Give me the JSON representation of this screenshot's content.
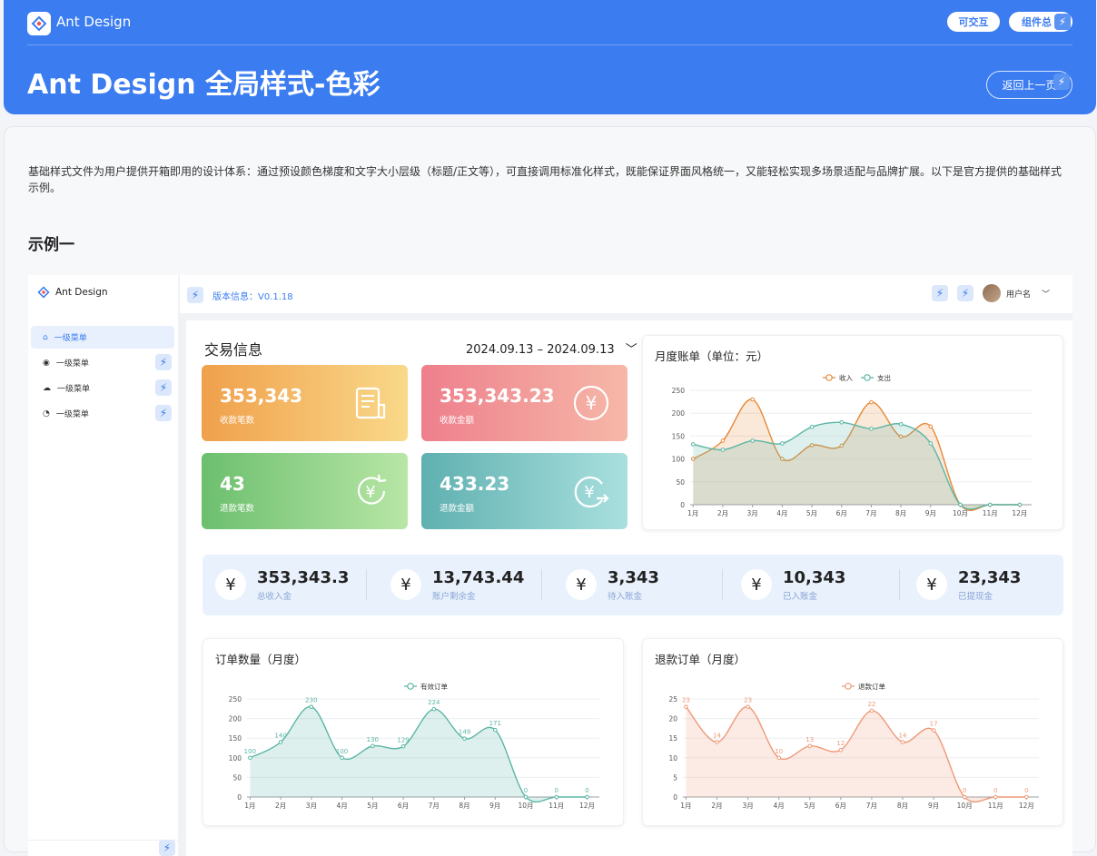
{
  "header": {
    "brand": "Ant Design",
    "title": "Ant Design 全局样式-色彩",
    "interactive_label": "可交互",
    "component_label": "组件总",
    "back_label": "返回上一页"
  },
  "intro": "基础样式文件为用户提供开箱即用的设计体系：通过预设颜色梯度和文字大小层级（标题/正文等），可直接调用标准化样式，既能保证界面风格统一，又能轻松实现多场景适配与品牌扩展。以下是官方提供的基础样式示例。",
  "section_title": "示例一",
  "demo": {
    "brand": "Ant Design",
    "version": "版本信息：V0.1.18",
    "username": "用户名",
    "menu": [
      {
        "label": "一级菜单",
        "icon": "home-icon"
      },
      {
        "label": "一级菜单",
        "icon": "record-icon"
      },
      {
        "label": "一级菜单",
        "icon": "cloud-icon"
      },
      {
        "label": "一级菜单",
        "icon": "pie-icon"
      }
    ],
    "trade_title": "交易信息",
    "date_range": "2024.09.13 – 2024.09.13",
    "cards": [
      {
        "value": "353,343",
        "label": "收款笔数",
        "icon": "receipt-icon",
        "colors": [
          "#f0a04b",
          "#f9d98a"
        ]
      },
      {
        "value": "353,343.23",
        "label": "收款金额",
        "icon": "yen-circle-icon",
        "colors": [
          "#ee7f8c",
          "#f6b8a8"
        ]
      },
      {
        "value": "43",
        "label": "退款笔数",
        "icon": "yen-refresh-icon",
        "colors": [
          "#6cbf6e",
          "#b8e6a6"
        ]
      },
      {
        "value": "433.23",
        "label": "退款金额",
        "icon": "yen-transfer-icon",
        "colors": [
          "#5fb0b0",
          "#a9e0de"
        ]
      }
    ],
    "stats": [
      {
        "value": "353,343.3",
        "label": "总收入金"
      },
      {
        "value": "13,743.44",
        "label": "账户剩余金"
      },
      {
        "value": "3,343",
        "label": "待入账金"
      },
      {
        "value": "10,343",
        "label": "已入账金"
      },
      {
        "value": "23,343",
        "label": "已提现金"
      }
    ]
  },
  "chart_data": [
    {
      "type": "area",
      "title": "月度账单（单位：元）",
      "categories": [
        "1月",
        "2月",
        "3月",
        "4月",
        "5月",
        "6月",
        "7月",
        "8月",
        "9月",
        "10月",
        "11月",
        "12月"
      ],
      "series": [
        {
          "name": "收入",
          "color": "#e58a3a",
          "values": [
            100,
            140,
            230,
            100,
            130,
            129,
            224,
            149,
            171,
            0,
            0,
            0
          ]
        },
        {
          "name": "支出",
          "color": "#5bb6a6",
          "values": [
            132,
            120,
            140,
            134,
            170,
            180,
            166,
            176,
            134,
            0,
            0,
            0
          ]
        }
      ],
      "ylim": [
        0,
        250
      ],
      "yticks": [
        0,
        50,
        100,
        150,
        200,
        250
      ],
      "legend": "top-center"
    },
    {
      "type": "area",
      "title": "订单数量（月度）",
      "categories": [
        "1月",
        "2月",
        "3月",
        "4月",
        "5月",
        "6月",
        "7月",
        "8月",
        "9月",
        "10月",
        "11月",
        "12月"
      ],
      "series": [
        {
          "name": "有效订单",
          "color": "#5bb6a6",
          "values": [
            100,
            140,
            230,
            100,
            130,
            129,
            224,
            149,
            171,
            0,
            0,
            0
          ]
        }
      ],
      "ylim": [
        0,
        250
      ],
      "yticks": [
        0,
        50,
        100,
        150,
        200,
        250
      ],
      "data_labels": true,
      "legend": "top-center"
    },
    {
      "type": "area",
      "title": "退款订单（月度）",
      "categories": [
        "1月",
        "2月",
        "3月",
        "4月",
        "5月",
        "6月",
        "7月",
        "8月",
        "9月",
        "10月",
        "11月",
        "12月"
      ],
      "series": [
        {
          "name": "退款订单",
          "color": "#ee9a78",
          "values": [
            23,
            14,
            23,
            10,
            13,
            12,
            22,
            14,
            17,
            0,
            0,
            0
          ]
        }
      ],
      "ylim": [
        0,
        25
      ],
      "yticks": [
        0,
        5,
        10,
        15,
        20,
        25
      ],
      "data_labels": true,
      "legend": "top-center"
    }
  ]
}
